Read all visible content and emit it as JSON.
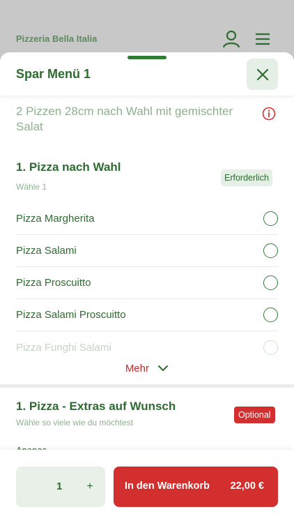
{
  "background": {
    "title": "Pizzeria Bella Italia",
    "icons": [
      "user-icon",
      "hamburger-menu-icon"
    ]
  },
  "sheet": {
    "title": "Spar Menü 1",
    "description": "2 Pizzen 28cm nach Wahl mit gemischter Salat"
  },
  "group1": {
    "title": "1. Pizza nach Wahl",
    "subtitle": "Wähle 1",
    "badge": "Erforderlich",
    "options": [
      {
        "label": "Pizza Margherita",
        "selected": false
      },
      {
        "label": "Pizza Salami",
        "selected": false
      },
      {
        "label": "Pizza Proscuitto",
        "selected": false
      },
      {
        "label": "Pizza Salami Proscuitto",
        "selected": false
      },
      {
        "label": "Pizza Funghi Salami",
        "selected": false
      }
    ],
    "more_label": "Mehr"
  },
  "group2": {
    "title": "1. Pizza - Extras auf Wunsch",
    "subtitle": "Wähle so viele wie du möchtest",
    "badge": "Optional",
    "next_item": "Ananas"
  },
  "footer": {
    "quantity": "1",
    "plus": "+",
    "cart_label": "In den Warenkorb",
    "price": "22,00 €"
  },
  "colors": {
    "green": "#2e6b30",
    "red": "#d32f2f",
    "light_green": "#e6efe6"
  }
}
